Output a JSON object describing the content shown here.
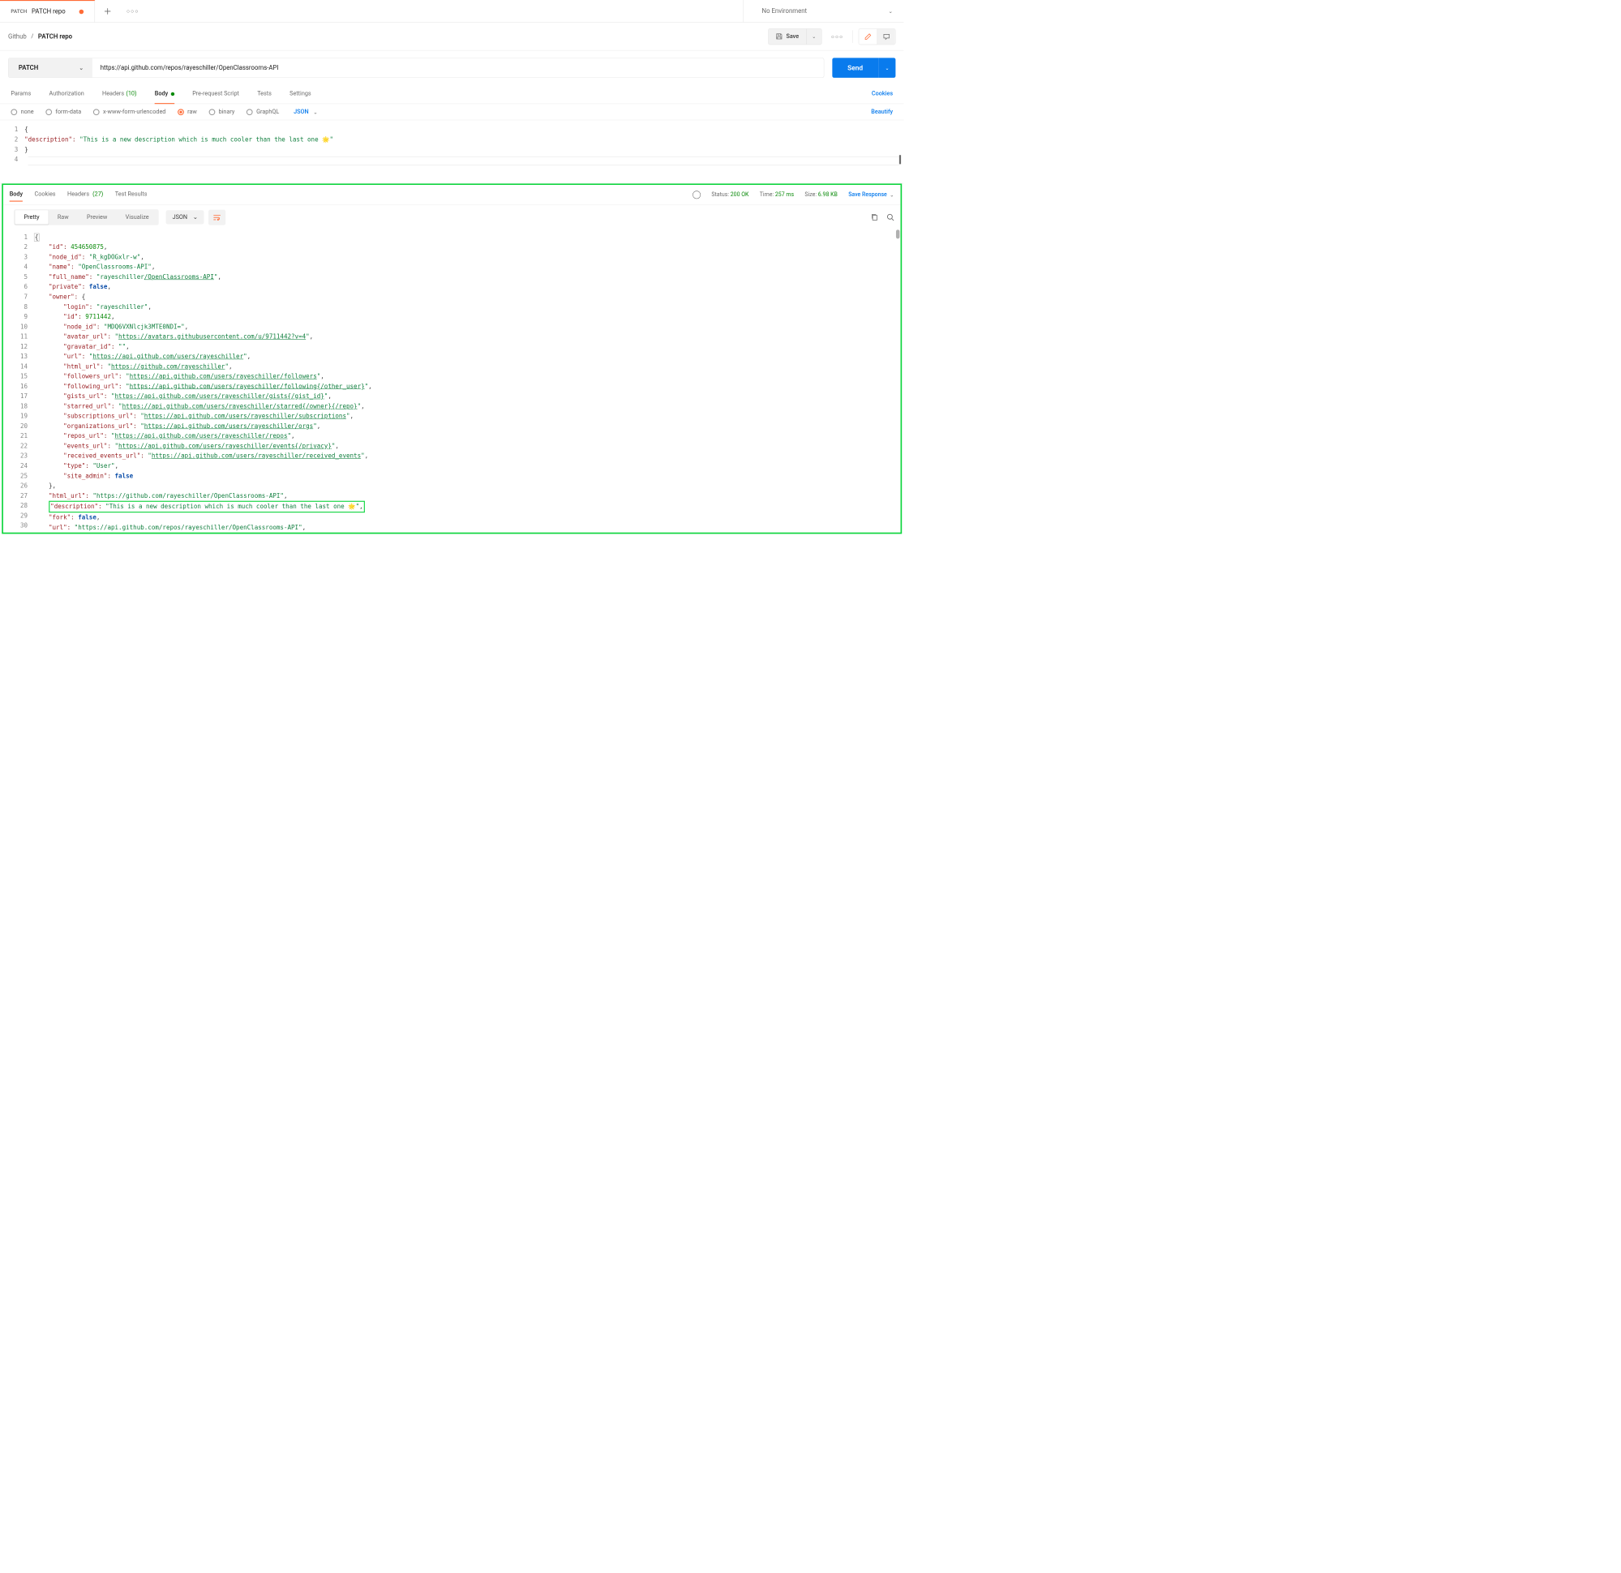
{
  "tab": {
    "method": "PATCH",
    "title": "PATCH repo"
  },
  "env": {
    "label": "No Environment"
  },
  "breadcrumb": {
    "root": "Github",
    "leaf": "PATCH repo"
  },
  "actions": {
    "save": "Save"
  },
  "url": {
    "method": "PATCH",
    "value": "https://api.github.com/repos/rayeschiller/OpenClassrooms-API",
    "send": "Send"
  },
  "req_tabs": {
    "params": "Params",
    "auth": "Authorization",
    "headers": "Headers",
    "headers_count": "(10)",
    "body": "Body",
    "prerequest": "Pre-request Script",
    "tests": "Tests",
    "settings": "Settings",
    "cookies": "Cookies"
  },
  "body_types": {
    "none": "none",
    "formdata": "form-data",
    "urlencoded": "x-www-form-urlencoded",
    "raw": "raw",
    "binary": "binary",
    "graphql": "GraphQL",
    "json": "JSON",
    "beautify": "Beautify"
  },
  "request_body": {
    "l1": "{",
    "l2_key": "\"description\"",
    "l2_val": "\"This is a new description which is much cooler than the last one 🌟\"",
    "l3": "}"
  },
  "resp_tabs": {
    "body": "Body",
    "cookies": "Cookies",
    "headers": "Headers",
    "headers_count": "(27)",
    "results": "Test Results"
  },
  "resp_meta": {
    "status_label": "Status:",
    "status": "200 OK",
    "time_label": "Time:",
    "time": "257 ms",
    "size_label": "Size:",
    "size": "6.98 KB",
    "save": "Save Response"
  },
  "view": {
    "pretty": "Pretty",
    "raw": "Raw",
    "preview": "Preview",
    "visualize": "Visualize",
    "json": "JSON"
  },
  "response_body": {
    "id": 454650875,
    "node_id": "R_kgDOGxlr-w",
    "name": "OpenClassrooms-API",
    "full_name_prefix": "rayeschiller",
    "full_name_suffix": "/OpenClassrooms-API",
    "private": "false",
    "owner": {
      "login": "rayeschiller",
      "id": 9711442,
      "node_id": "MDQ6VXNlcjk3MTE0NDI=",
      "avatar_url": "https://avatars.githubusercontent.com/u/9711442?v=4",
      "gravatar_id": "",
      "url": "https://api.github.com/users/rayeschiller",
      "html_url": "https://github.com/rayeschiller",
      "followers_url": "https://api.github.com/users/rayeschiller/followers",
      "following_url": "https://api.github.com/users/rayeschiller/following{/other_user}",
      "gists_url": "https://api.github.com/users/rayeschiller/gists{/gist_id}",
      "starred_url": "https://api.github.com/users/rayeschiller/starred{/owner}{/repo}",
      "subscriptions_url": "https://api.github.com/users/rayeschiller/subscriptions",
      "organizations_url": "https://api.github.com/users/rayeschiller/orgs",
      "repos_url": "https://api.github.com/users/rayeschiller/repos",
      "events_url": "https://api.github.com/users/rayeschiller/events{/privacy}",
      "received_events_url": "https://api.github.com/users/rayeschiller/received_events",
      "type": "User",
      "site_admin": "false"
    },
    "html_url": "https://github.com/rayeschiller/OpenClassrooms-API",
    "description": "This is a new description which is much cooler than the last one 🌟",
    "fork": "false",
    "url": "https://api.github.com/repos/rayeschiller/OpenClassrooms-API"
  }
}
